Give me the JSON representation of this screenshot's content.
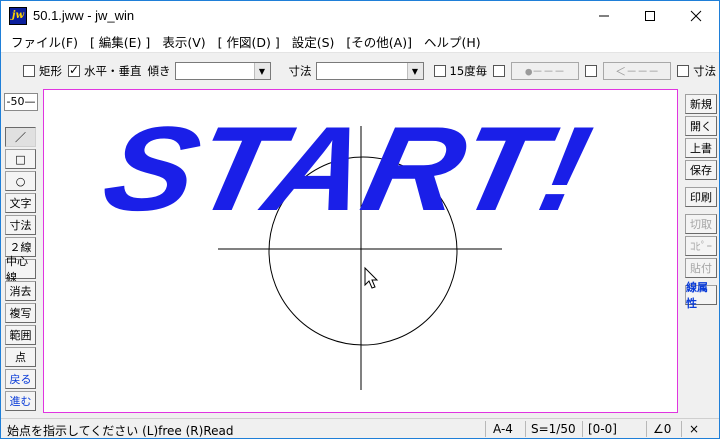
{
  "window": {
    "title": "50.1.jww - jw_win",
    "app_icon_text": "jw",
    "controls": {
      "minimize": "minimize",
      "maximize": "maximize",
      "close": "close"
    }
  },
  "menu": [
    "ファイル(F)",
    "[ 編集(E) ]",
    "表示(V)",
    "[ 作図(D) ]",
    "設定(S)",
    "[その他(A)]",
    "ヘルプ(H)"
  ],
  "toolbar": {
    "rect_label": "矩形",
    "rect_checked": false,
    "hv_label": "水平・垂直",
    "hv_checked": true,
    "tilt_label": "傾き",
    "tilt_value": "",
    "dim_label": "寸法",
    "dim_value": "",
    "deg15_label": "15度毎",
    "deg15_checked": false,
    "line_style_1": "●－－－",
    "line_style_2": "＜－－－",
    "dim2_label": "寸法"
  },
  "left_tools": {
    "scale_value": "-50—",
    "items": [
      "／",
      "□",
      "○",
      "文字",
      "寸法",
      "２線",
      "中心線",
      "消去",
      "複写",
      "範囲",
      "点",
      "戻る",
      "進む"
    ]
  },
  "right_tools": {
    "items": [
      "新規",
      "開く",
      "上書",
      "保存",
      "印刷",
      "切取",
      "ｺﾋﾟｰ",
      "貼付",
      "線属性"
    ]
  },
  "canvas": {
    "banner_text": "START!",
    "banner_color": "#1a1fe8",
    "frame_color": "#e035e0"
  },
  "status": {
    "message": "始点を指示してください (L)free (R)Read",
    "paper": "A-4",
    "scale": "S=1/50",
    "layer": "[0-0]",
    "angle": "∠0",
    "zoom": "×"
  }
}
